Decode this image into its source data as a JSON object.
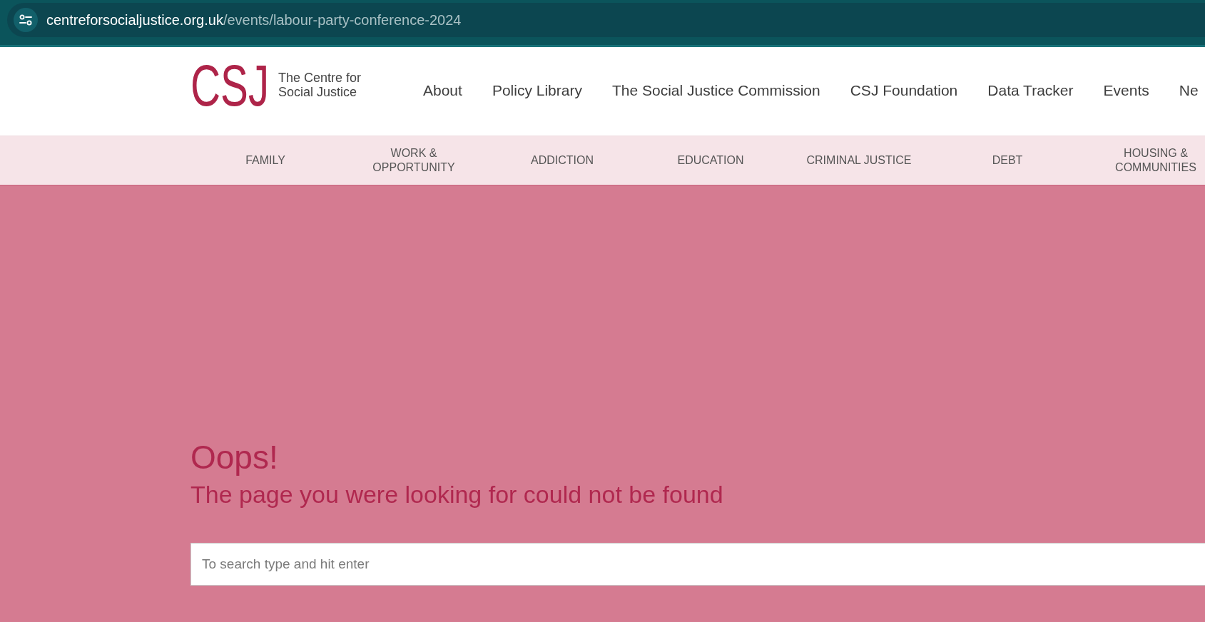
{
  "browser": {
    "address_bar": {
      "host": "centreforsocialjustice.org.uk",
      "path": "/events/labour-party-conference-2024"
    }
  },
  "header": {
    "logo": {
      "mark": "CSJ",
      "tagline": "The Centre for Social Justice"
    },
    "nav": [
      "About",
      "Policy Library",
      "The Social Justice Commission",
      "CSJ Foundation",
      "Data Tracker",
      "Events",
      "Ne"
    ]
  },
  "categories": [
    "FAMILY",
    "WORK & OPPORTUNITY",
    "ADDICTION",
    "EDUCATION",
    "CRIMINAL JUSTICE",
    "DEBT",
    "HOUSING & COMMUNITIES"
  ],
  "error": {
    "title": "Oops!",
    "message": "The page you were looking for could not be found"
  },
  "search": {
    "placeholder": "To search type and hit enter"
  }
}
